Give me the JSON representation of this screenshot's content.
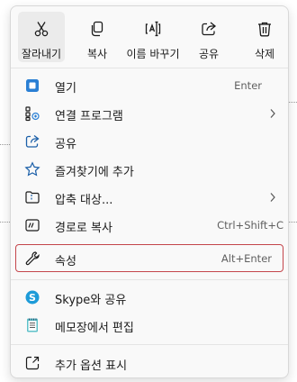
{
  "toolbar": {
    "buttons": [
      {
        "label": "잘라내기",
        "icon": "scissors-icon"
      },
      {
        "label": "복사",
        "icon": "copy-icon"
      },
      {
        "label": "이름 바꾸기",
        "icon": "rename-icon"
      },
      {
        "label": "공유",
        "icon": "share-icon"
      },
      {
        "label": "삭제",
        "icon": "trash-icon"
      }
    ]
  },
  "menu": {
    "items": [
      {
        "label": "열기",
        "shortcut": "Enter",
        "icon": "open-icon"
      },
      {
        "label": "연결 프로그램",
        "shortcut": "",
        "icon": "open-with-icon",
        "submenu": true
      },
      {
        "label": "공유",
        "shortcut": "",
        "icon": "share-icon"
      },
      {
        "label": "즐겨찾기에 추가",
        "shortcut": "",
        "icon": "star-icon"
      },
      {
        "label": "압축 대상...",
        "shortcut": "",
        "icon": "zip-folder-icon",
        "submenu": true
      },
      {
        "label": "경로로 복사",
        "shortcut": "Ctrl+Shift+C",
        "icon": "copy-path-icon"
      },
      {
        "label": "속성",
        "shortcut": "Alt+Enter",
        "icon": "wrench-icon",
        "highlighted": true
      },
      {
        "label": "Skype와 공유",
        "shortcut": "",
        "icon": "skype-icon"
      },
      {
        "label": "메모장에서 편집",
        "shortcut": "",
        "icon": "notepad-icon"
      },
      {
        "label": "추가 옵션 표시",
        "shortcut": "",
        "icon": "more-options-icon"
      }
    ]
  },
  "colors": {
    "highlight_border": "#c4454b",
    "accent": "#0f6cbd",
    "menu_background": "#f9f9f9"
  }
}
